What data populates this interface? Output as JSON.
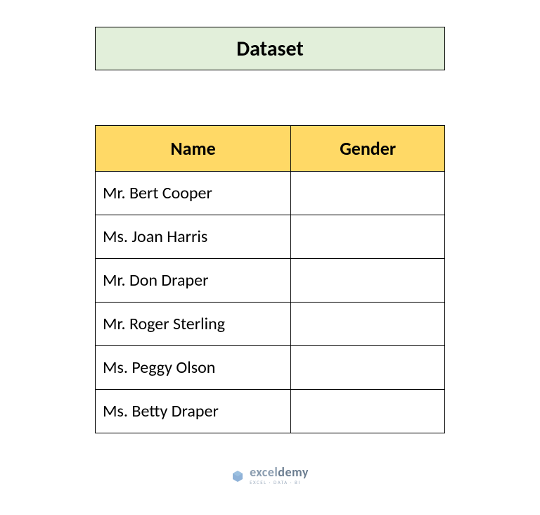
{
  "title": "Dataset",
  "table": {
    "headers": {
      "name": "Name",
      "gender": "Gender"
    },
    "rows": [
      {
        "name": "Mr. Bert Cooper",
        "gender": ""
      },
      {
        "name": "Ms. Joan Harris",
        "gender": ""
      },
      {
        "name": "Mr. Don Draper",
        "gender": ""
      },
      {
        "name": "Mr. Roger Sterling",
        "gender": ""
      },
      {
        "name": "Ms. Peggy Olson",
        "gender": ""
      },
      {
        "name": "Ms. Betty Draper",
        "gender": ""
      }
    ]
  },
  "footer": {
    "brand_prefix": "excel",
    "brand_suffix": "demy",
    "tagline": "EXCEL · DATA · BI"
  }
}
